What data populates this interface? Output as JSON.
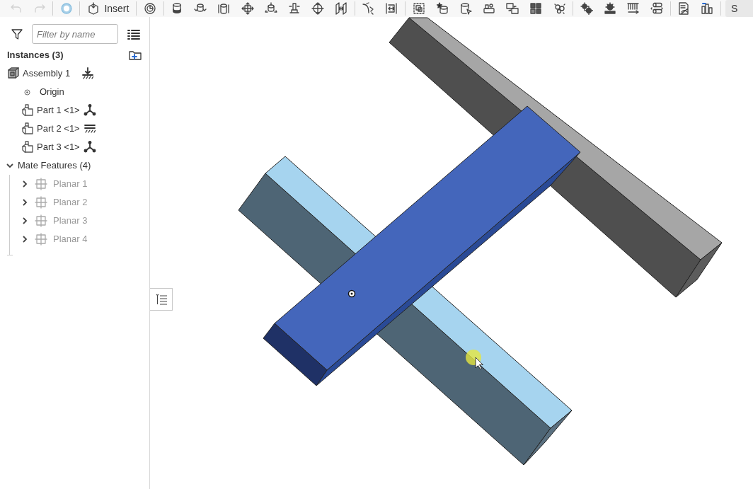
{
  "toolbar": {
    "undo": {
      "disabled": true
    },
    "redo": {
      "disabled": true
    },
    "insert_button": {
      "label": "Insert"
    },
    "edge_button": {
      "label": "S"
    }
  },
  "sidebar": {
    "filter": {
      "placeholder": "Filter by name"
    },
    "instances": {
      "title": "Instances (3)",
      "items": [
        {
          "label": "Assembly 1",
          "kind": "assembly",
          "fixed": true
        },
        {
          "label": "Origin",
          "kind": "origin"
        },
        {
          "label": "Part 1 <1>",
          "kind": "part",
          "fixed": false
        },
        {
          "label": "Part 2 <1>",
          "kind": "part",
          "fixed": true
        },
        {
          "label": "Part 3 <1>",
          "kind": "part",
          "fixed": false
        }
      ]
    },
    "mate_features": {
      "title": "Mate Features (4)",
      "expanded": true,
      "items": [
        {
          "label": "Planar 1",
          "expanded": false,
          "suppressed": true
        },
        {
          "label": "Planar 2",
          "expanded": false,
          "suppressed": true
        },
        {
          "label": "Planar 3",
          "expanded": false,
          "suppressed": true
        },
        {
          "label": "Planar 4",
          "expanded": false,
          "suppressed": true
        }
      ]
    }
  }
}
